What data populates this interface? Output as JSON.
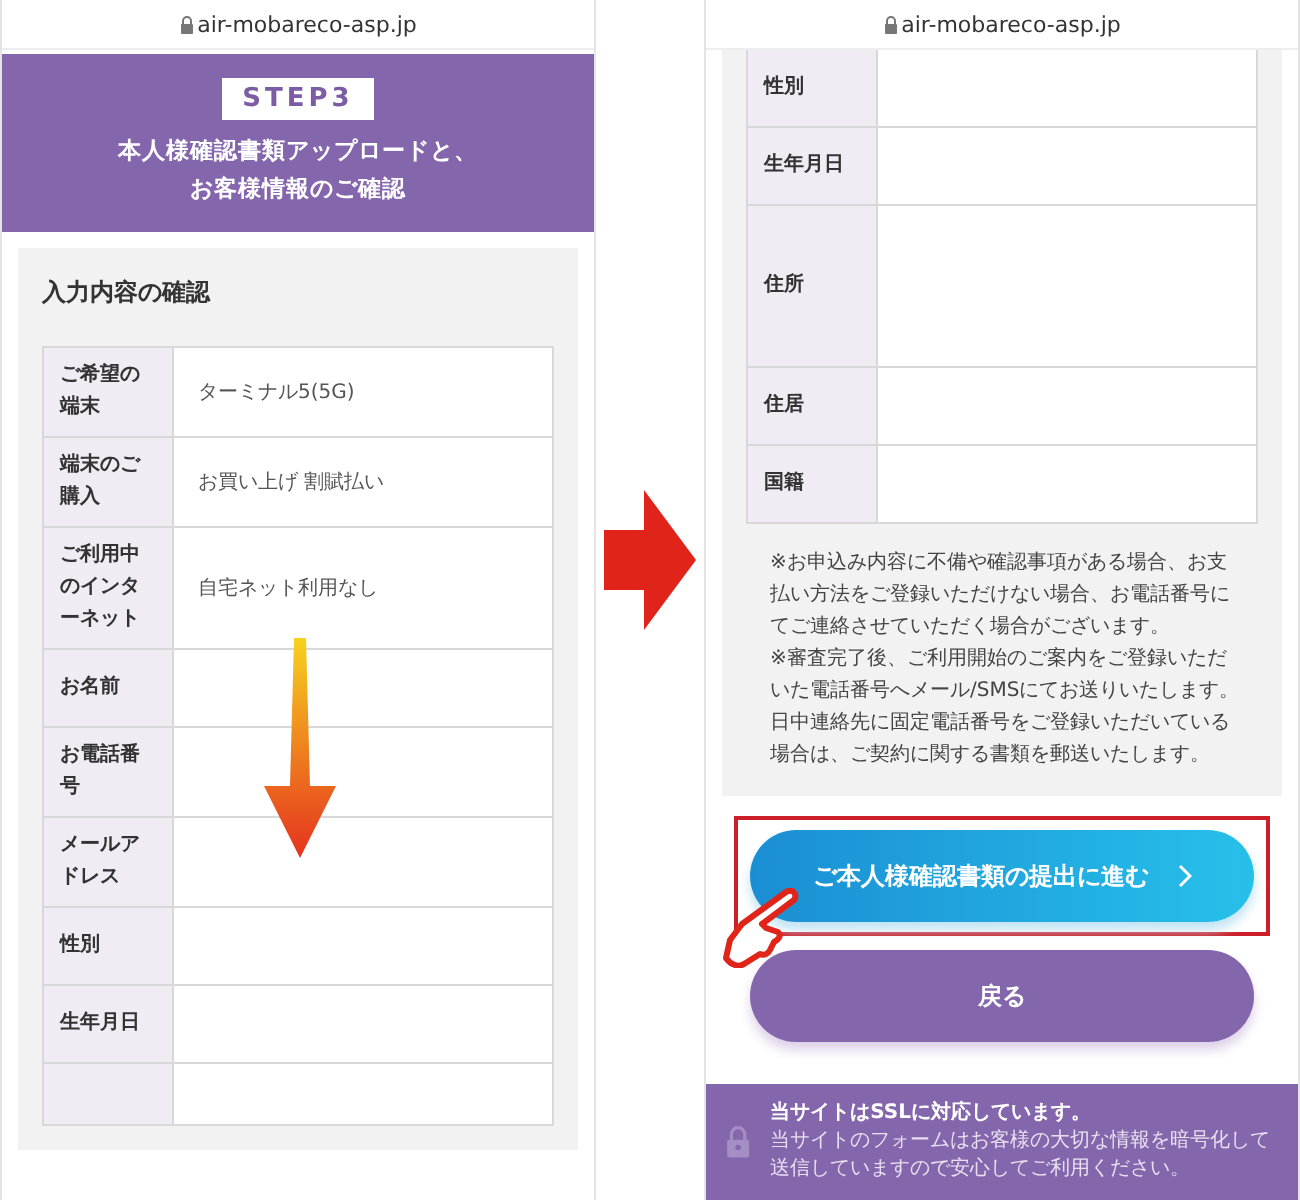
{
  "screens": [
    {
      "url": "air-mobareco-asp.jp",
      "header": {
        "step": "STEP3",
        "title_lines": [
          "本人様確認書類アップロードと、",
          "お客様情報のご確認"
        ]
      },
      "panel_title": "入力内容の確認",
      "rows": [
        {
          "label": "ご希望の端末",
          "value": "ターミナル5(5G)"
        },
        {
          "label": "端末のご購入",
          "value": "お買い上げ 割賦払い"
        },
        {
          "label": "ご利用中のインターネット",
          "value": "自宅ネット利用なし"
        },
        {
          "label": "お名前"
        },
        {
          "label": "お電話番号"
        },
        {
          "label": "メールアドレス"
        },
        {
          "label": "性別"
        },
        {
          "label": "生年月日"
        },
        {
          "kind": "cut"
        }
      ]
    },
    {
      "url": "air-mobareco-asp.jp",
      "rows": [
        {
          "label": "性別"
        },
        {
          "label": "生年月日"
        },
        {
          "label": "住所",
          "kind": "tall"
        },
        {
          "label": "住居"
        },
        {
          "label": "国籍"
        }
      ],
      "notes": [
        "※お申込み内容に不備や確認事項がある場合、お支払い方法をご登録いただけない場合、お電話番号にてご連絡させていただく場合がございます。",
        "※審査完了後、ご利用開始のご案内をご登録いただいた電話番号へメール/SMSにてお送りいたします。",
        "日中連絡先に固定電話番号をご登録いただいている場合は、ご契約に関する書類を郵送いたします。"
      ],
      "buttons": [
        {
          "label": "ご本人様確認書類の提出に進む",
          "kind": "primary",
          "highlighted": true
        },
        {
          "label": "戻る",
          "kind": "back",
          "highlighted": false
        }
      ],
      "footer": {
        "title": "当サイトはSSLに対応しています。",
        "text": "当サイトのフォームはお客様の大切な情報を暗号化して送信していますので安心してご利用ください。"
      }
    }
  ]
}
